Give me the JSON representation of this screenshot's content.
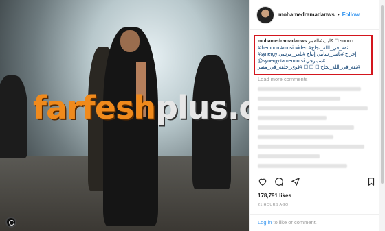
{
  "post": {
    "username": "mohamedramadanws",
    "follow_label": "Follow",
    "separator": "•",
    "caption_line1_user": "mohamedramadanws",
    "caption_line1_rest": " كليب #القمر ☐ sooon",
    "caption_line2": "#themoon #musicvideo #ثقة_في_الله_نجاح",
    "caption_line3": "#synergy إخراج #ياسر_سامي إنتاج #تامر_مرسي",
    "caption_line4": "@synergy.tamermursi سينرجي#",
    "caption_line5": "ثقة_في_الله_نجاح ☐ ☐ ☐ #قوي_حلقة_في_مصر#",
    "load_more": "Load more comments",
    "likes": "178,791 likes",
    "time": "21 HOURS AGO",
    "footer_login": "Log in",
    "footer_rest": " to like or comment."
  },
  "watermark": {
    "part1": "farfesh",
    "part2": "plus.com"
  },
  "icons": {
    "heart": "heart-icon",
    "comment": "comment-icon",
    "share": "share-icon",
    "bookmark": "bookmark-icon",
    "camera": "camera-badge-icon"
  },
  "colors": {
    "link": "#3897f0",
    "highlight_box": "#d3161e",
    "watermark_orange": "#f08a1c"
  }
}
